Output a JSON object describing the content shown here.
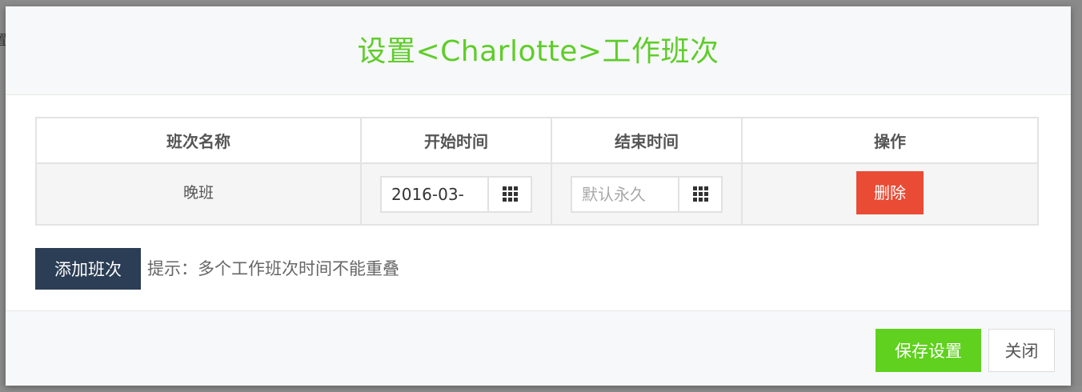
{
  "background": {
    "partial_glyph": "置"
  },
  "dialog": {
    "title": "设置<Charlotte>工作班次",
    "title_color": "#5fcd2a"
  },
  "table": {
    "headers": [
      "班次名称",
      "开始时间",
      "结束时间",
      "操作"
    ],
    "rows": [
      {
        "name": "晚班",
        "start_value": "2016-03-",
        "end_placeholder": "默认永久",
        "delete_label": "删除"
      }
    ]
  },
  "actions": {
    "add_label": "添加班次",
    "hint": "提示：多个工作班次时间不能重叠"
  },
  "footer": {
    "save_label": "保存设置",
    "close_label": "关闭"
  },
  "colors": {
    "save": "#5fd11e",
    "delete": "#e94b35",
    "add": "#2c3e55"
  },
  "icons": {
    "date_picker": "grid-icon"
  }
}
